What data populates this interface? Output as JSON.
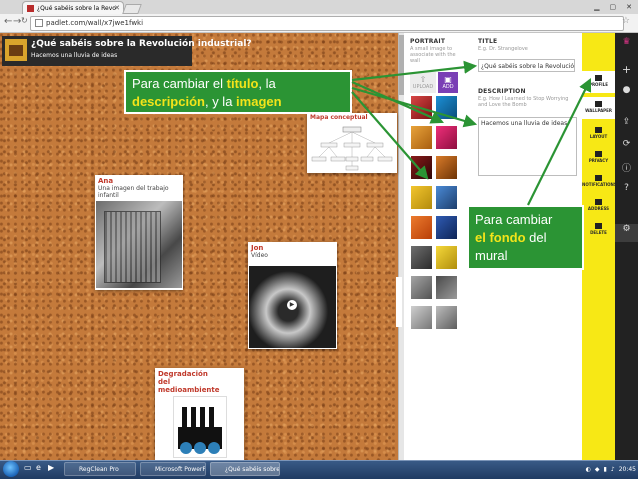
{
  "browser": {
    "tab_title": "¿Qué sabéis sobre la Revo",
    "url": "padlet.com/wall/x7jwe1fwki"
  },
  "wall": {
    "title": "¿Qué sabéis sobre la Revolución industrial?",
    "subtitle": "Hacemos una lluvia de ideas",
    "posts": [
      {
        "title": "Ana",
        "body": "Una imagen del trabajo infantil"
      },
      {
        "title": "Jon",
        "body": "Vídeo"
      },
      {
        "title": "Degradación del medioambiente",
        "body": ""
      },
      {
        "title": "Mapa conceptual",
        "body": ""
      }
    ]
  },
  "callouts": {
    "c1_part1": "Para cambiar el ",
    "c1_titulo": "título",
    "c1_part2": ", la ",
    "c1_descripcion": "descripción",
    "c1_part3": ", y la ",
    "c1_imagen": "imagen",
    "c2_part1": "Para cambiar ",
    "c2_fondo": "el fondo",
    "c2_part2": " del mural"
  },
  "panel": {
    "portrait_label": "PORTRAIT",
    "portrait_hint": "A small image to associate with the wall",
    "upload_label": "UPLOAD",
    "add_label": "ADD",
    "title_label": "TITLE",
    "title_hint": "E.g. Dr. Strangelove",
    "title_value": "¿Qué sabéis sobre la Revolución inc",
    "description_label": "DESCRIPTION",
    "description_hint": "E.g. How I Learned to Stop Worrying and Love the Bomb",
    "description_value": "Hacemos una lluvia de ideas"
  },
  "settings_menu": [
    {
      "label": "PROFILE",
      "icon": "profile-icon"
    },
    {
      "label": "WALLPAPER",
      "icon": "wallpaper-icon"
    },
    {
      "label": "LAYOUT",
      "icon": "layout-icon"
    },
    {
      "label": "PRIVACY",
      "icon": "lock-icon"
    },
    {
      "label": "NOTIFICATIONS",
      "icon": "mail-icon"
    },
    {
      "label": "ADDRESS",
      "icon": "link-icon"
    },
    {
      "label": "DELETE",
      "icon": "trash-icon"
    }
  ],
  "taskbar": {
    "items": [
      "RegClean Pro",
      "Microsoft PowerPoi...",
      "¿Qué sabéis sobre la..."
    ],
    "clock": "20:45"
  },
  "colors": {
    "callout_green": "#2b9434",
    "highlight_yellow": "#f3e41a",
    "settings_yellow": "#f7e815",
    "cork": "#c47a3b"
  }
}
